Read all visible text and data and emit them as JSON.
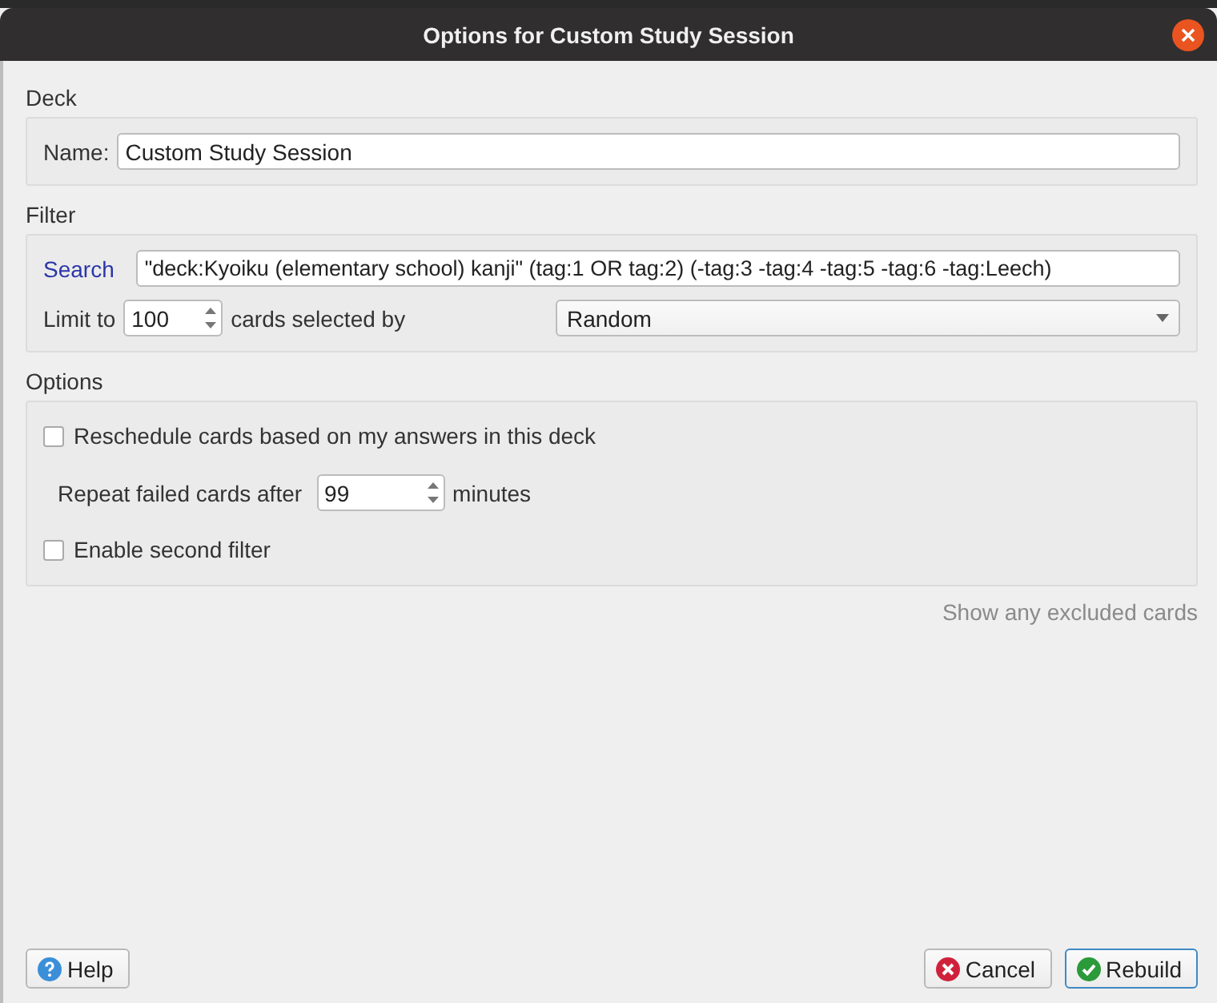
{
  "window": {
    "title": "Options for Custom Study Session"
  },
  "deck": {
    "heading": "Deck",
    "name_label": "Name:",
    "name_value": "Custom Study Session"
  },
  "filter": {
    "heading": "Filter",
    "search_label": "Search",
    "search_value": "\"deck:Kyoiku (elementary school) kanji\" (tag:1 OR tag:2) (-tag:3 -tag:4 -tag:5 -tag:6 -tag:Leech)",
    "limit_label": "Limit to",
    "limit_value": "100",
    "selected_by_label": "cards selected by",
    "order": "Random"
  },
  "options": {
    "heading": "Options",
    "reschedule": {
      "label": "Reschedule cards based on my answers in this deck",
      "checked": false
    },
    "repeat_label": "Repeat failed cards after",
    "repeat_value": "99",
    "repeat_unit": "minutes",
    "second_filter": {
      "label": "Enable second filter",
      "checked": false
    }
  },
  "excluded_link": "Show any excluded cards",
  "buttons": [
    {
      "label": "Help",
      "kind": "help",
      "default": false
    },
    {
      "label": "Cancel",
      "kind": "cancel",
      "default": false
    },
    {
      "label": "Rebuild",
      "kind": "rebuild",
      "default": true
    }
  ]
}
